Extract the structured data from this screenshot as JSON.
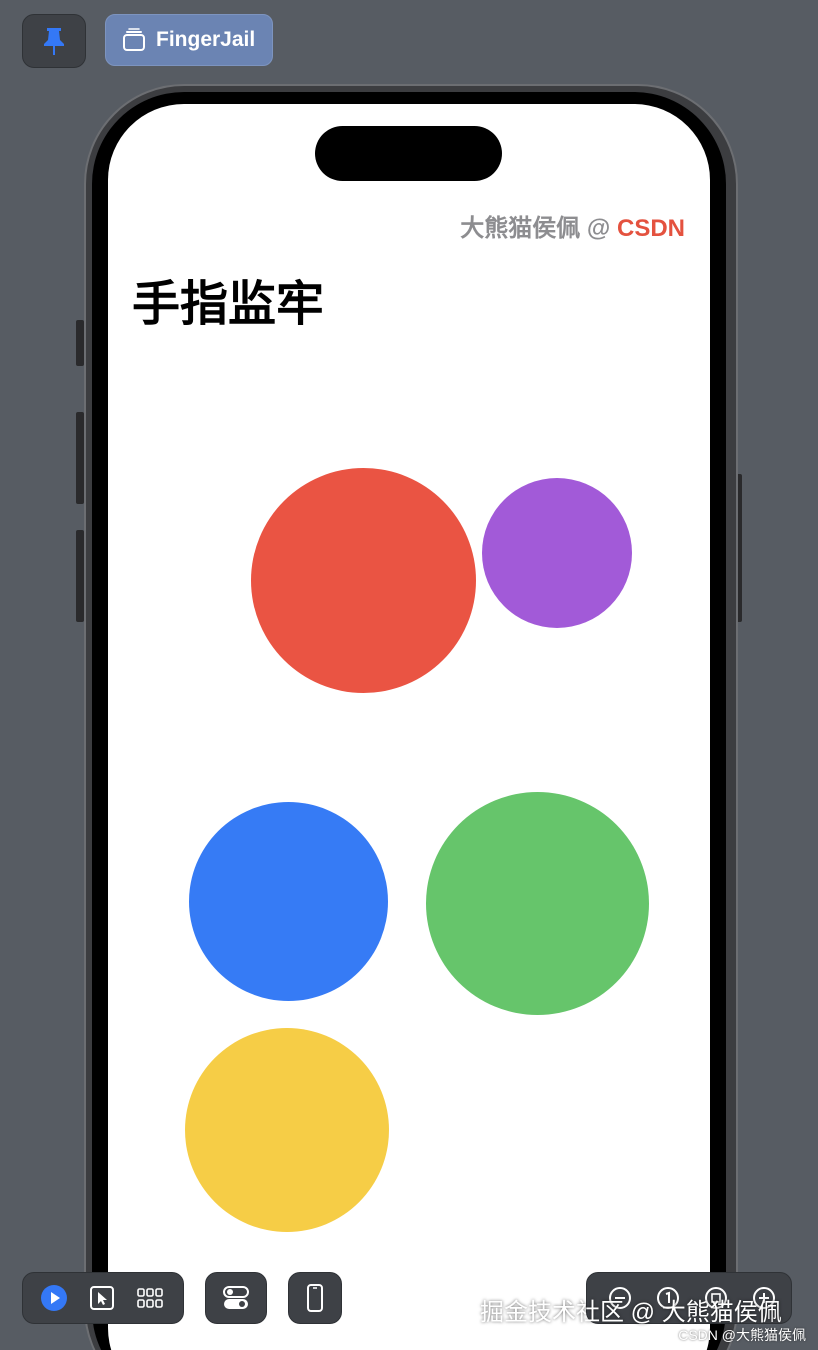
{
  "toolbar": {
    "pin_icon": "pin-icon",
    "preview_label": "FingerJail",
    "preview_icon": "stack-icon",
    "accent": "#3478f6"
  },
  "app": {
    "credit_author": "大熊猫侯佩 @ ",
    "credit_brand": "CSDN",
    "title": "手指监牢",
    "colors": {
      "red": "#ea5443",
      "purple": "#a25ad8",
      "blue": "#367bf5",
      "green": "#66c56b",
      "yellow": "#f6cd46"
    }
  },
  "bottom_toolbar": {
    "icons": [
      "play-icon",
      "select-icon",
      "grid-icon",
      "settings-toggle-icon",
      "device-icon",
      "zoom-out-icon",
      "zoom-actual-icon",
      "zoom-fit-icon",
      "zoom-in-icon"
    ]
  },
  "watermark": {
    "main": "掘金技术社区 @ 大熊猫侯佩",
    "small": "CSDN @大熊猫侯佩"
  }
}
